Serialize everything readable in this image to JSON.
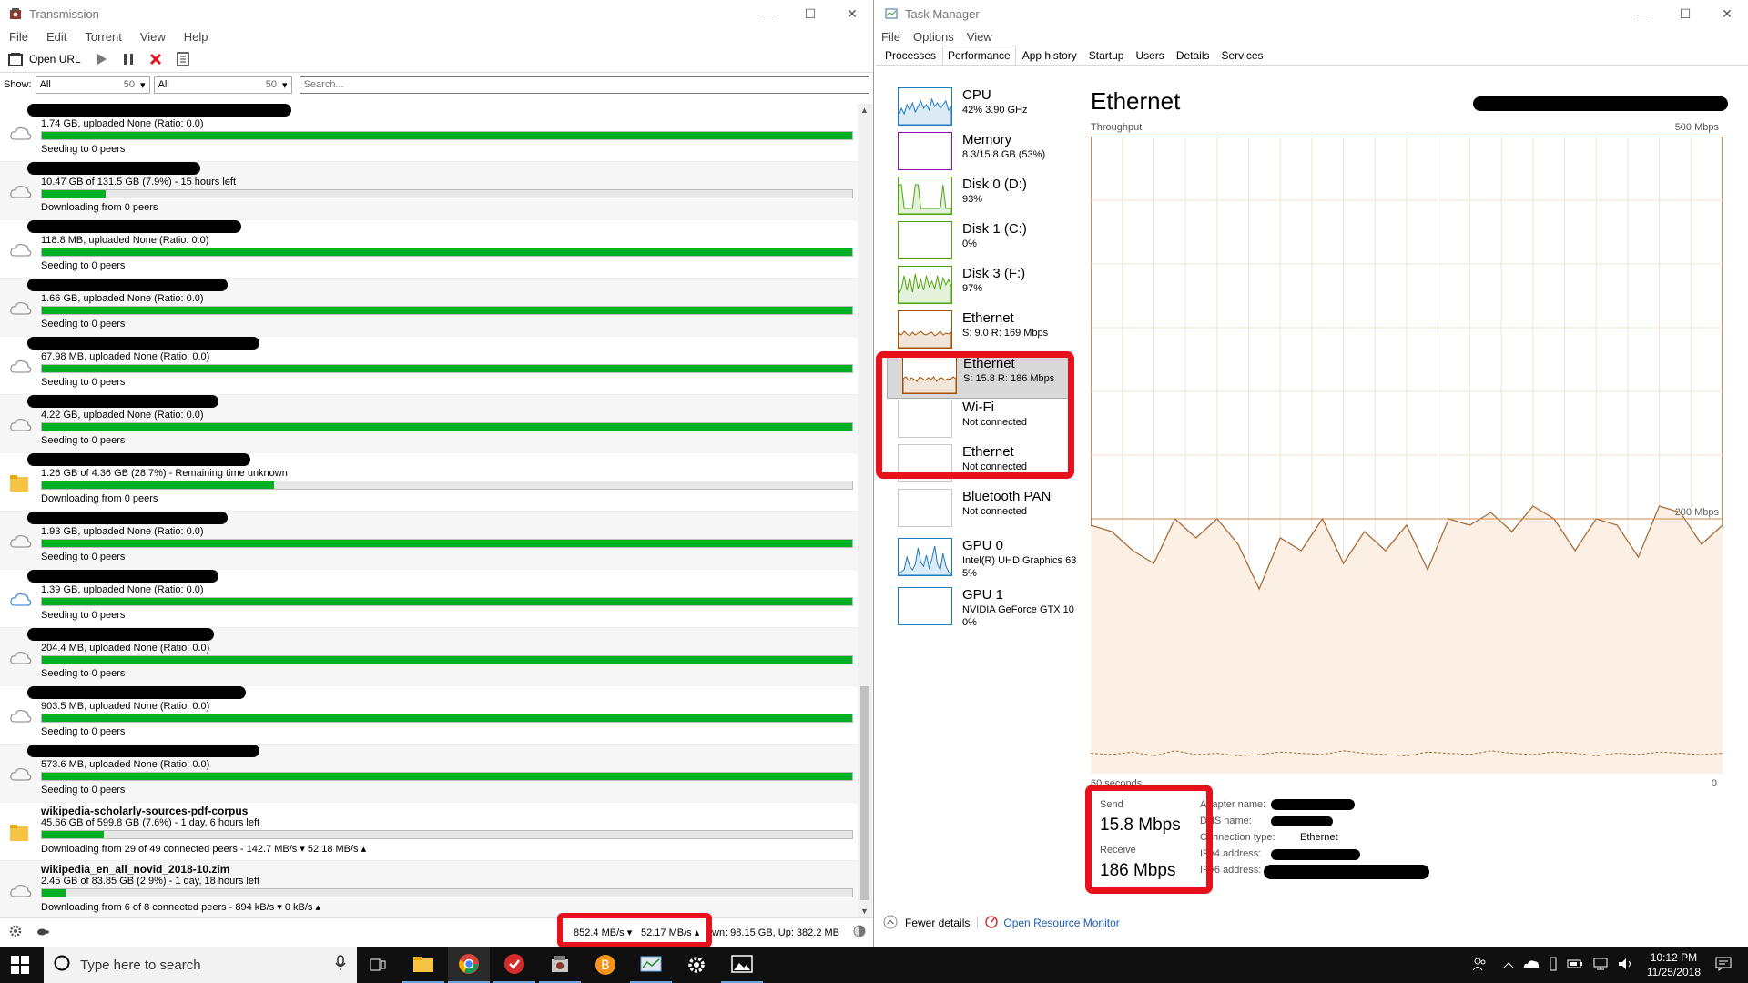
{
  "transmission": {
    "title": "Transmission",
    "menu": [
      "File",
      "Edit",
      "Torrent",
      "View",
      "Help"
    ],
    "toolbar": {
      "open_url": "Open URL"
    },
    "filter": {
      "show_label": "Show:",
      "sel1": "All",
      "sel1_count": "50",
      "sel2": "All",
      "sel2_count": "50",
      "search_placeholder": "Search..."
    },
    "torrents": [
      {
        "name": "",
        "progress": "1.74 GB, uploaded None (Ratio: 0.0)",
        "status": "Seeding to 0 peers",
        "percent": 100,
        "icon": "cloud"
      },
      {
        "name": "",
        "progress": "10.47 GB of 131.5 GB (7.9%) - 15 hours left",
        "status": "Downloading from 0 peers",
        "percent": 7.9,
        "icon": "cloud"
      },
      {
        "name": "",
        "progress": "118.8 MB, uploaded None (Ratio: 0.0)",
        "status": "Seeding to 0 peers",
        "percent": 100,
        "icon": "cloud"
      },
      {
        "name": "",
        "progress": "1.66 GB, uploaded None (Ratio: 0.0)",
        "status": "Seeding to 0 peers",
        "percent": 100,
        "icon": "cloud"
      },
      {
        "name": "",
        "progress": "67.98 MB, uploaded None (Ratio: 0.0)",
        "status": "Seeding to 0 peers",
        "percent": 100,
        "icon": "cloud"
      },
      {
        "name": "",
        "progress": "4.22 GB, uploaded None (Ratio: 0.0)",
        "status": "Seeding to 0 peers",
        "percent": 100,
        "icon": "cloud"
      },
      {
        "name": "",
        "progress": "1.26 GB of 4.36 GB (28.7%) - Remaining time unknown",
        "status": "Downloading from 0 peers",
        "percent": 28.7,
        "icon": "folder"
      },
      {
        "name": "",
        "progress": "1.93 GB, uploaded None (Ratio: 0.0)",
        "status": "Seeding to 0 peers",
        "percent": 100,
        "icon": "cloud"
      },
      {
        "name": "",
        "progress": "1.39 GB, uploaded None (Ratio: 0.0)",
        "status": "Seeding to 0 peers",
        "percent": 100,
        "icon": "cloud-blue"
      },
      {
        "name": "",
        "progress": "204.4 MB, uploaded None (Ratio: 0.0)",
        "status": "Seeding to 0 peers",
        "percent": 100,
        "icon": "cloud"
      },
      {
        "name": "",
        "progress": "903.5 MB, uploaded None (Ratio: 0.0)",
        "status": "Seeding to 0 peers",
        "percent": 100,
        "icon": "cloud"
      },
      {
        "name": "",
        "progress": "573.6 MB, uploaded None (Ratio: 0.0)",
        "status": "Seeding to 0 peers",
        "percent": 100,
        "icon": "cloud"
      },
      {
        "name": "wikipedia-scholarly-sources-pdf-corpus",
        "progress": "45.66 GB of 599.8 GB (7.6%) - 1 day, 6 hours left",
        "status": "Downloading from 29 of 49 connected peers - 142.7 MB/s ▾  52.18 MB/s ▴",
        "percent": 7.6,
        "icon": "folder"
      },
      {
        "name": "wikipedia_en_all_novid_2018-10.zim",
        "progress": "2.45 GB of 83.85 GB (2.9%) - 1 day, 18 hours left",
        "status": "Downloading from 6 of 8 connected peers - 894 kB/s ▾  0 kB/s ▴",
        "percent": 2.9,
        "icon": "cloud"
      }
    ],
    "status": {
      "down": "852.4 MB/s ▾",
      "up": "52.17 MB/s ▴",
      "totals": "wn: 98.15 GB, Up: 382.2 MB"
    }
  },
  "taskmanager": {
    "title": "Task Manager",
    "menu": [
      "File",
      "Options",
      "View"
    ],
    "tabs": [
      "Processes",
      "Performance",
      "App history",
      "Startup",
      "Users",
      "Details",
      "Services"
    ],
    "active_tab": "Performance",
    "items": [
      {
        "name": "CPU",
        "sub": "42% 3.90 GHz",
        "color": "#1b7ac4"
      },
      {
        "name": "Memory",
        "sub": "8.3/15.8 GB (53%)",
        "color": "#8b12ae"
      },
      {
        "name": "Disk 0 (D:)",
        "sub": "93%",
        "color": "#4da60c"
      },
      {
        "name": "Disk 1 (C:)",
        "sub": "0%",
        "color": "#4da60c"
      },
      {
        "name": "Disk 3 (F:)",
        "sub": "97%",
        "color": "#4da60c"
      },
      {
        "name": "Ethernet",
        "sub": "S: 9.0  R: 169 Mbps",
        "color": "#a74f01"
      },
      {
        "name": "Ethernet",
        "sub": "S: 15.8  R: 186 Mbps",
        "color": "#a74f01"
      },
      {
        "name": "Wi-Fi",
        "sub": "Not connected",
        "color": "#c8c8c8"
      },
      {
        "name": "Ethernet",
        "sub": "Not connected",
        "color": "#c8c8c8"
      },
      {
        "name": "Bluetooth PAN",
        "sub": "Not connected",
        "color": "#c8c8c8"
      },
      {
        "name": "GPU 0",
        "sub": "Intel(R) UHD Graphics 63",
        "sub2": "5%",
        "color": "#1b7ac4"
      },
      {
        "name": "GPU 1",
        "sub": "NVIDIA GeForce GTX 10",
        "sub2": "0%",
        "color": "#1b7ac4"
      }
    ],
    "detail": {
      "title": "Ethernet",
      "throughput": "Throughput",
      "max": "500 Mbps",
      "mid": "200 Mbps",
      "seconds": "60 seconds",
      "zero": "0",
      "send_label": "Send",
      "send_value": "15.8 Mbps",
      "receive_label": "Receive",
      "receive_value": "186 Mbps",
      "kv": [
        {
          "k": "Adapter name:",
          "v": ""
        },
        {
          "k": "DNS name:",
          "v": ""
        },
        {
          "k": "Connection type:",
          "v": "Ethernet"
        },
        {
          "k": "IPv4 address:",
          "v": ""
        },
        {
          "k": "IPv6 address:",
          "v": ""
        }
      ]
    },
    "footer": {
      "fewer": "Fewer details",
      "resmon": "Open Resource Monitor"
    }
  },
  "chart_data": {
    "type": "area",
    "title": "",
    "xlabel": "60 seconds",
    "ylabel": "Throughput",
    "ylim": [
      0,
      500
    ],
    "x": [
      0,
      2,
      4,
      6,
      8,
      10,
      12,
      14,
      16,
      18,
      20,
      22,
      24,
      26,
      28,
      30,
      32,
      34,
      36,
      38,
      40,
      42,
      44,
      46,
      48,
      50,
      52,
      54,
      56,
      58,
      60
    ],
    "series": [
      {
        "name": "Receive",
        "values": [
          195,
          190,
          175,
          165,
          200,
          185,
          200,
          180,
          145,
          185,
          175,
          200,
          165,
          190,
          175,
          195,
          160,
          200,
          195,
          205,
          190,
          210,
          200,
          175,
          200,
          195,
          170,
          210,
          205,
          180,
          195
        ]
      },
      {
        "name": "Send",
        "values": [
          16,
          15,
          17,
          14,
          18,
          15,
          16,
          14,
          15,
          17,
          16,
          15,
          18,
          16,
          15,
          14,
          17,
          16,
          15,
          18,
          16,
          15,
          17,
          16,
          14,
          16,
          15,
          17,
          16,
          15,
          16
        ]
      }
    ]
  },
  "taskbar": {
    "search_placeholder": "Type here to search",
    "time": "10:12 PM",
    "date": "11/25/2018"
  }
}
